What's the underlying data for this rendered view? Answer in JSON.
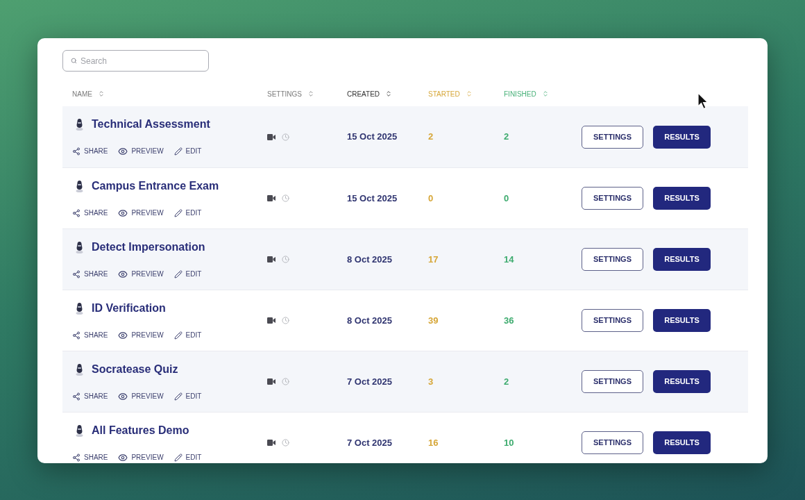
{
  "search": {
    "placeholder": "Search"
  },
  "table": {
    "columns": [
      {
        "label": "NAME",
        "color": "#7a7a7a"
      },
      {
        "label": "SETTINGS",
        "color": "#7a7a7a"
      },
      {
        "label": "CREATED",
        "color": "#2e2e2e"
      },
      {
        "label": "STARTED",
        "color": "#d6a637"
      },
      {
        "label": "FINISHED",
        "color": "#47b078"
      }
    ],
    "rows": [
      {
        "name": "Technical Assessment",
        "created": "15 Oct 2025",
        "started": "2",
        "finished": "2",
        "actions": [
          {
            "kind": "share",
            "label": "SHARE"
          },
          {
            "kind": "preview",
            "label": "PREVIEW"
          },
          {
            "kind": "edit",
            "label": "EDIT"
          }
        ],
        "buttons": [
          {
            "kind": "outline",
            "label": "SETTINGS"
          },
          {
            "kind": "primary",
            "label": "RESULTS"
          }
        ]
      },
      {
        "name": "Campus Entrance Exam",
        "created": "15 Oct 2025",
        "started": "0",
        "finished": "0",
        "actions": [
          {
            "kind": "share",
            "label": "SHARE"
          },
          {
            "kind": "preview",
            "label": "PREVIEW"
          },
          {
            "kind": "edit",
            "label": "EDIT"
          }
        ],
        "buttons": [
          {
            "kind": "outline",
            "label": "SETTINGS"
          },
          {
            "kind": "primary",
            "label": "RESULTS"
          }
        ]
      },
      {
        "name": "Detect Impersonation",
        "created": "8 Oct 2025",
        "started": "17",
        "finished": "14",
        "actions": [
          {
            "kind": "share",
            "label": "SHARE"
          },
          {
            "kind": "preview",
            "label": "PREVIEW"
          },
          {
            "kind": "edit",
            "label": "EDIT"
          }
        ],
        "buttons": [
          {
            "kind": "outline",
            "label": "SETTINGS"
          },
          {
            "kind": "primary",
            "label": "RESULTS"
          }
        ]
      },
      {
        "name": "ID Verification",
        "created": "8 Oct 2025",
        "started": "39",
        "finished": "36",
        "actions": [
          {
            "kind": "share",
            "label": "SHARE"
          },
          {
            "kind": "preview",
            "label": "PREVIEW"
          },
          {
            "kind": "edit",
            "label": "EDIT"
          }
        ],
        "buttons": [
          {
            "kind": "outline",
            "label": "SETTINGS"
          },
          {
            "kind": "primary",
            "label": "RESULTS"
          }
        ]
      },
      {
        "name": "Socratease Quiz",
        "created": "7 Oct 2025",
        "started": "3",
        "finished": "2",
        "actions": [
          {
            "kind": "share",
            "label": "SHARE"
          },
          {
            "kind": "preview",
            "label": "PREVIEW"
          },
          {
            "kind": "edit",
            "label": "EDIT"
          }
        ],
        "buttons": [
          {
            "kind": "outline",
            "label": "SETTINGS"
          },
          {
            "kind": "primary",
            "label": "RESULTS"
          }
        ]
      },
      {
        "name": "All Features Demo",
        "created": "7 Oct 2025",
        "started": "16",
        "finished": "10",
        "actions": [
          {
            "kind": "share",
            "label": "SHARE"
          },
          {
            "kind": "preview",
            "label": "PREVIEW"
          },
          {
            "kind": "edit",
            "label": "EDIT"
          }
        ],
        "buttons": [
          {
            "kind": "outline",
            "label": "SETTINGS"
          },
          {
            "kind": "primary",
            "label": "RESULTS"
          }
        ]
      }
    ]
  }
}
